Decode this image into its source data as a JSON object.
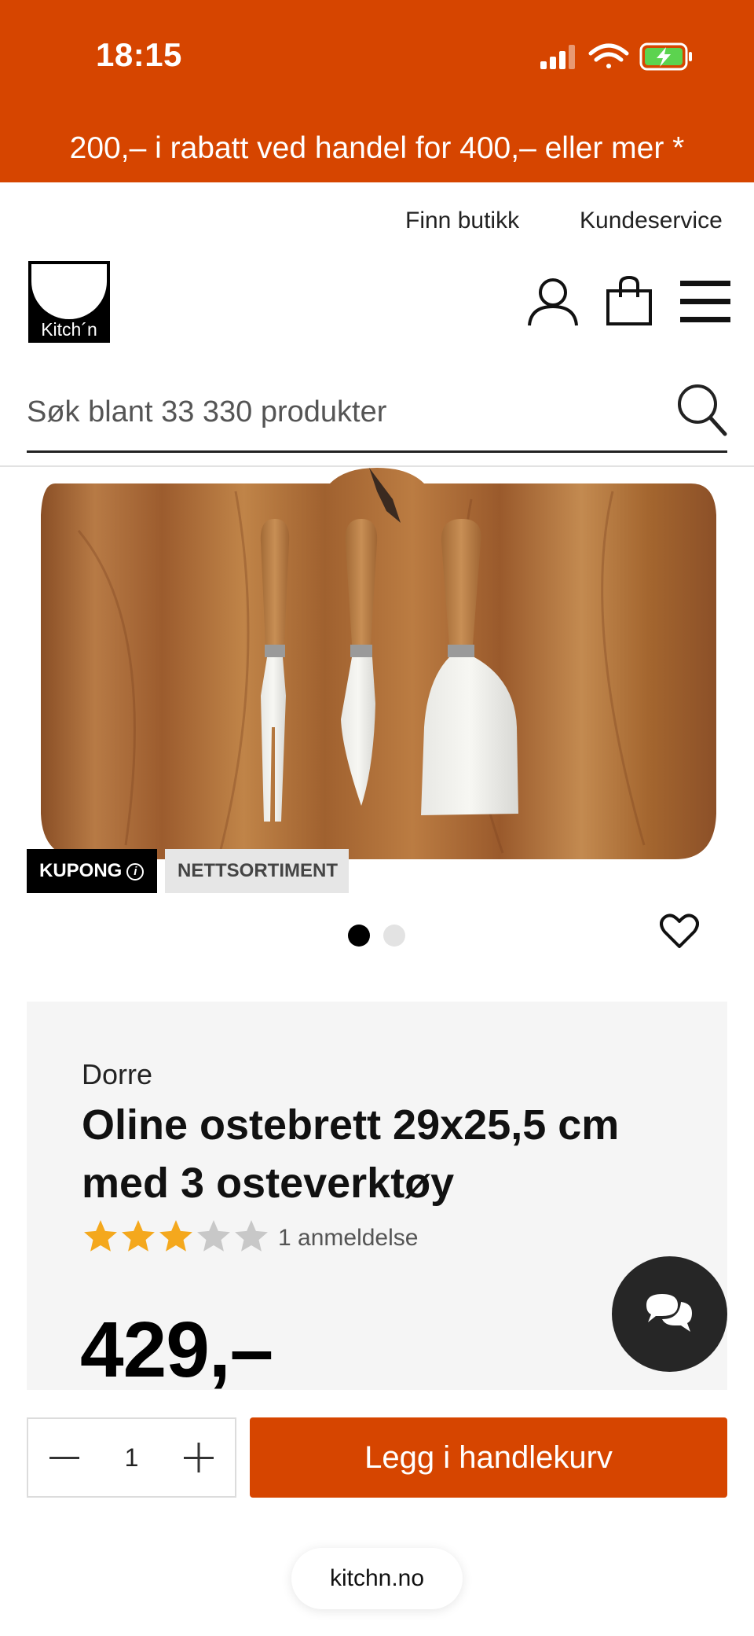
{
  "status_bar": {
    "time": "18:15",
    "icons": [
      "signal-icon",
      "wifi-icon",
      "battery-charging-icon"
    ]
  },
  "promo": {
    "text": "200,– i rabatt ved handel for 400,– eller mer *"
  },
  "header": {
    "find_store": "Finn butikk",
    "customer_service": "Kundeservice",
    "logo_text": "Kitch´n",
    "icons": [
      "account-icon",
      "bag-icon",
      "menu-icon"
    ]
  },
  "search": {
    "placeholder": "Søk blant 33 330 produkter"
  },
  "badges": {
    "coupon": "KUPONG",
    "coupon_info": "i",
    "web_only": "NETTSORTIMENT"
  },
  "gallery": {
    "current": 1,
    "total": 2
  },
  "product": {
    "brand": "Dorre",
    "title": "Oline ostebrett 29x25,5 cm med 3 osteverktøy",
    "rating": 3,
    "rating_max": 5,
    "reviews": "1 anmeldelse",
    "price": "429,–"
  },
  "cart": {
    "quantity": "1",
    "add_label": "Legg i handlekurv"
  },
  "browser": {
    "url": "kitchn.no"
  },
  "colors": {
    "brand": "#d64500",
    "star_filled": "#f4a81d",
    "star_empty": "#c8c8c8"
  }
}
